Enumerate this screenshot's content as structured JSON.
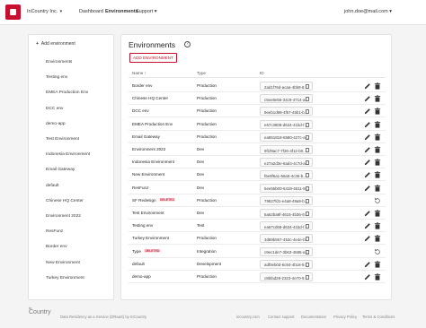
{
  "header": {
    "org": "InCountry Inc.",
    "nav": [
      "Dashboard",
      "Environments",
      "Support"
    ],
    "user": "john.doe@mail.com"
  },
  "sidebar": {
    "add_label": "Add environment",
    "items": [
      "Environments",
      "Testing env",
      "EMEA Production Env",
      "DCC env",
      "demo-app",
      "Test Environment",
      "Indonesia Environment",
      "Email Gateway",
      "default",
      "Chinese HQ Center",
      "Environment 2022",
      "ResFunz",
      "Border env",
      "New Environment",
      "Turkey Environment"
    ]
  },
  "main": {
    "title": "Environments",
    "add_button": "ADD ENVIRONMENT",
    "columns": [
      "Name",
      "Type",
      "ID"
    ],
    "rows": [
      {
        "name": "Border env",
        "badge": "",
        "type": "Production",
        "id": "2ad1f76d-acaa-4bb8-8..."
      },
      {
        "name": "Chinese HQ Center",
        "badge": "",
        "type": "Production",
        "id": "c5ee8e56-34c9-4714-a..."
      },
      {
        "name": "DCC env",
        "badge": "",
        "type": "Production",
        "id": "9eeb1d98-4f57-45b1-b..."
      },
      {
        "name": "EMEA Production Env",
        "badge": "",
        "type": "Production",
        "id": "e67c3808-d634-41bd-f..."
      },
      {
        "name": "Email Gateway",
        "badge": "",
        "type": "Production",
        "id": "ea851818-6580-427c-a..."
      },
      {
        "name": "Environment 2022",
        "badge": "",
        "type": "Dev",
        "id": "9f1f8ac7-7f26-4f12-b0..."
      },
      {
        "name": "Indonesia Environment",
        "badge": "",
        "type": "Dev",
        "id": "e27a2d3e-6ad4-4c7d-a..."
      },
      {
        "name": "New Environment",
        "badge": "",
        "type": "Dev",
        "id": "f6e9f6a1-66a5-4c36-b..."
      },
      {
        "name": "ResFunz",
        "badge": "",
        "type": "Dev",
        "id": "5ee55b00-6418-4611-9..."
      },
      {
        "name": "SF Redesign",
        "badge": "DELETED",
        "type": "Production",
        "id": "79827fd1-e4a8-49a9-b..."
      },
      {
        "name": "Test Environment",
        "badge": "",
        "type": "Dev",
        "id": "6a62ba8f-4615-4b36-9..."
      },
      {
        "name": "Testing env",
        "badge": "",
        "type": "Test",
        "id": "ea67cd68-d634-41bd-f..."
      },
      {
        "name": "Turkey Environment",
        "badge": "",
        "type": "Production",
        "id": "3d89b567-453c-4e4e-b..."
      },
      {
        "name": "Type",
        "badge": "DELETED",
        "type": "Integration",
        "id": "c9ec1de7-3b63-4685-a..."
      },
      {
        "name": "default",
        "badge": "",
        "type": "Development",
        "id": "adf0eb0d-6c94-4b18-9..."
      },
      {
        "name": "demo-app",
        "badge": "",
        "type": "Production",
        "id": "c8bfad28-2323-4e70-9..."
      }
    ]
  },
  "footer": {
    "logo_small": "In",
    "logo": "Country",
    "tagline": "Data Residency as a Service (DRaaS) by InCountry",
    "links": [
      "incountry.com",
      "Contact support",
      "Documentation",
      "Privacy Policy",
      "Terms & Conditions"
    ]
  },
  "colors": {
    "accent": "#c8102e",
    "badge_bg": "#fde2e4"
  }
}
